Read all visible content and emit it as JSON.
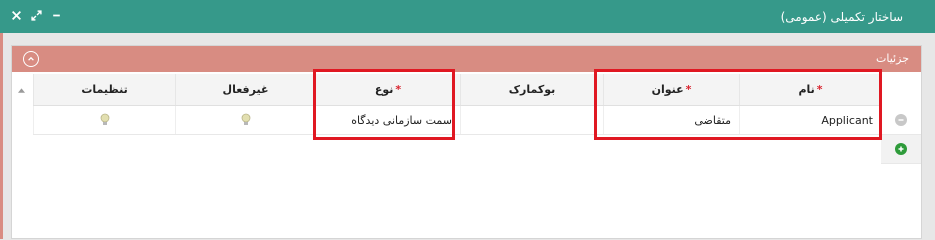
{
  "window": {
    "title": "ساختار تکمیلی (عمومی)",
    "controls": [
      "minimize-icon",
      "maximize-icon",
      "close-icon"
    ]
  },
  "panel": {
    "title": "جزئیات",
    "toggle_icon": "chevron-up-icon"
  },
  "grid": {
    "columns": [
      {
        "key": "settings",
        "label": "تنظیمات",
        "required": false
      },
      {
        "key": "disable",
        "label": "غیرفعال",
        "required": false
      },
      {
        "key": "type",
        "label": "نوع",
        "required": true
      },
      {
        "key": "bookmark",
        "label": "بوکمارک",
        "required": false
      },
      {
        "key": "title",
        "label": "عنوان",
        "required": true
      },
      {
        "key": "name",
        "label": "نام",
        "required": true
      }
    ],
    "required_marker": "*",
    "rows": [
      {
        "settings": "bulb-icon",
        "disable": "bulb-icon",
        "type": "سمت سازمانی دیدگاه",
        "bookmark": "",
        "title": "متقاضی",
        "name": "Applicant"
      }
    ]
  },
  "colors": {
    "titlebar": "#36998a",
    "panel_header": "#d88c82",
    "highlight": "#e01822",
    "add_button": "#2e9b3a",
    "required": "#d9232e"
  }
}
